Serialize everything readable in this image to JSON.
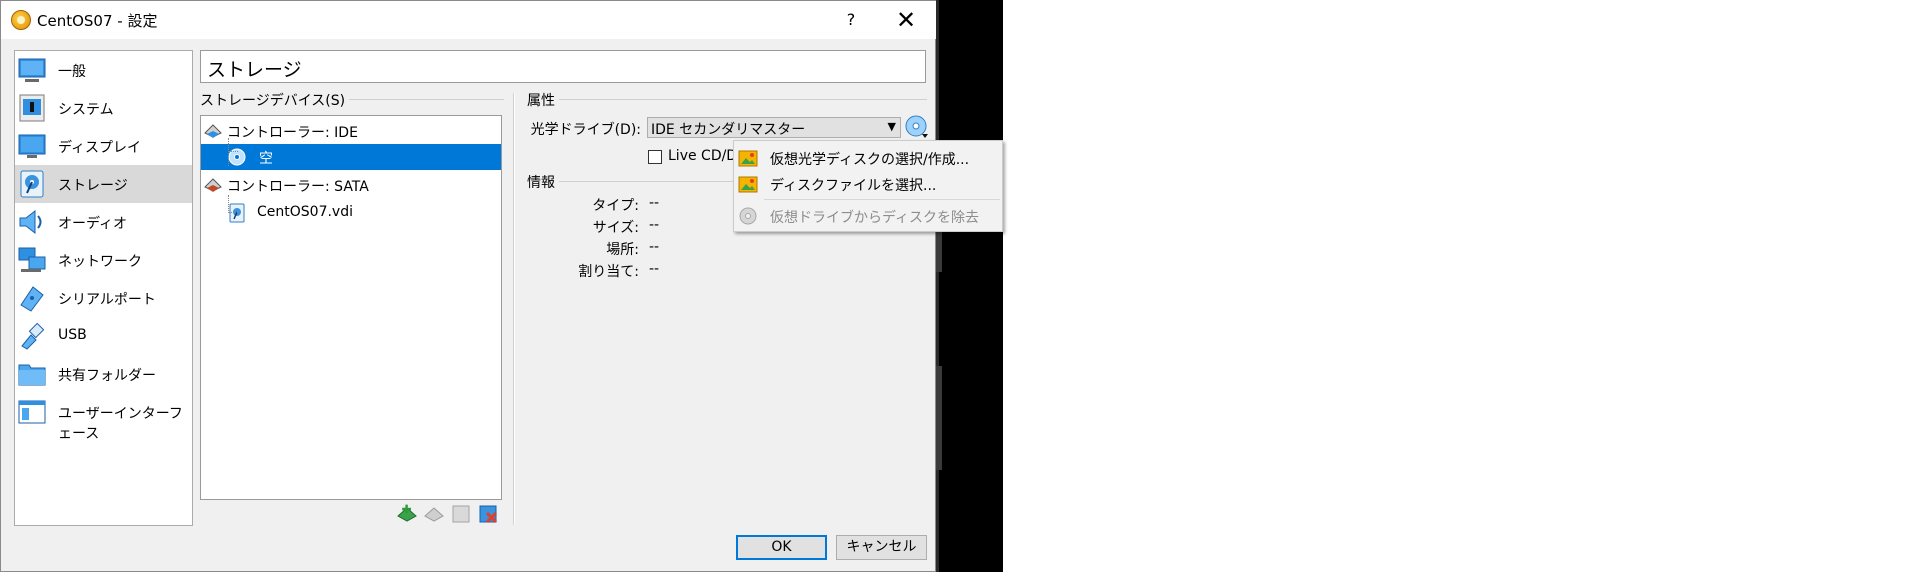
{
  "window": {
    "title": "CentOS07 - 設定",
    "help": "?",
    "close": "✕"
  },
  "nav": {
    "items": [
      {
        "label": "一般",
        "icon": "general-icon"
      },
      {
        "label": "システム",
        "icon": "system-icon"
      },
      {
        "label": "ディスプレイ",
        "icon": "display-icon"
      },
      {
        "label": "ストレージ",
        "icon": "storage-icon",
        "selected": true
      },
      {
        "label": "オーディオ",
        "icon": "audio-icon"
      },
      {
        "label": "ネットワーク",
        "icon": "network-icon"
      },
      {
        "label": "シリアルポート",
        "icon": "serial-port-icon"
      },
      {
        "label": "USB",
        "icon": "usb-icon"
      },
      {
        "label": "共有フォルダー",
        "icon": "shared-folder-icon"
      },
      {
        "label": "ユーザーインターフェース",
        "icon": "user-interface-icon"
      }
    ]
  },
  "page": {
    "title": "ストレージ"
  },
  "storage_devices": {
    "group_title": "ストレージデバイス(S)",
    "tree": [
      {
        "label": "コントローラー: IDE",
        "type": "controller"
      },
      {
        "label": "空",
        "type": "optical",
        "selected": true
      },
      {
        "label": "コントローラー: SATA",
        "type": "controller"
      },
      {
        "label": "CentOS07.vdi",
        "type": "disk"
      }
    ]
  },
  "attributes": {
    "group_title": "属性",
    "optical_drive_label": "光学ドライブ(D):",
    "optical_drive_value": "IDE セカンダリマスター",
    "live_cd_label": "Live CD/DVD"
  },
  "info": {
    "group_title": "情報",
    "rows": [
      {
        "label": "タイプ:",
        "value": "--"
      },
      {
        "label": "サイズ:",
        "value": "--"
      },
      {
        "label": "場所:",
        "value": "--"
      },
      {
        "label": "割り当て:",
        "value": "--"
      }
    ]
  },
  "popup_menu": {
    "items": [
      {
        "label": "仮想光学ディスクの選択/作成...",
        "enabled": true
      },
      {
        "label": "ディスクファイルを選択...",
        "enabled": true
      },
      {
        "label": "仮想ドライブからディスクを除去",
        "enabled": false
      }
    ]
  },
  "buttons": {
    "ok": "OK",
    "cancel": "キャンセル"
  },
  "colors": {
    "selection": "#0078d7",
    "nav_selected": "#d9d9d9",
    "dialog_bg": "#f0f0f0"
  }
}
